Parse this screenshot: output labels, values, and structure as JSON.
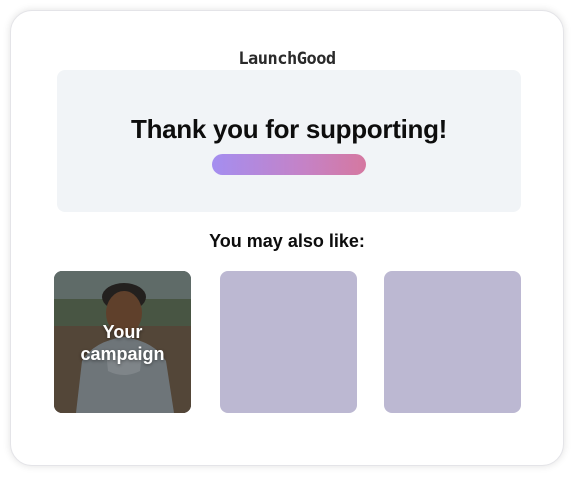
{
  "brand": {
    "name": "LaunchGood"
  },
  "thanks": {
    "title": "Thank you for supporting!"
  },
  "suggestions": {
    "heading": "You may also like:",
    "tiles": [
      {
        "label_line1": "Your",
        "label_line2": "campaign",
        "image": "child-photo"
      },
      {
        "label_line1": "",
        "label_line2": "",
        "image": "placeholder"
      },
      {
        "label_line1": "",
        "label_line2": "",
        "image": "placeholder"
      }
    ]
  },
  "colors": {
    "panel_bg": "#f1f4f7",
    "placeholder_tile": "#bcb8d2",
    "gradient_start": "#a48ef0",
    "gradient_end": "#d578a0",
    "text": "#0d0d0d"
  }
}
